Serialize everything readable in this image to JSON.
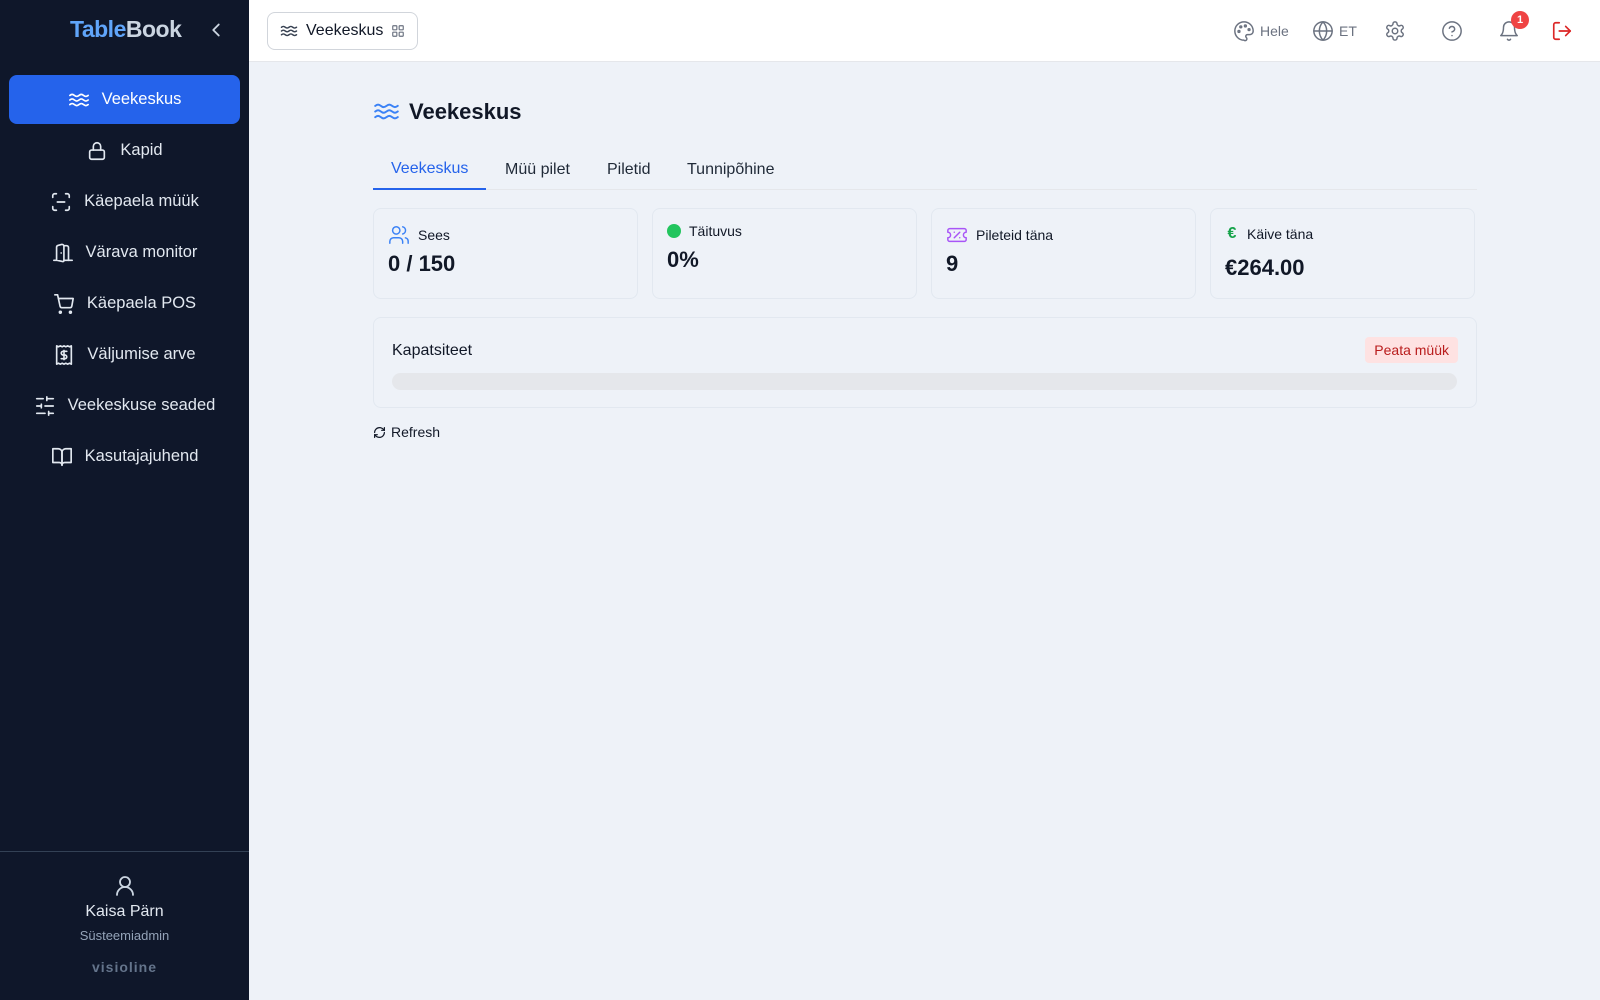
{
  "sidebar": {
    "brand_part1": "Table",
    "brand_part2": "Book",
    "items": [
      {
        "label": "Veekeskus",
        "icon": "waves-icon",
        "active": true
      },
      {
        "label": "Kapid",
        "icon": "lock-icon"
      },
      {
        "label": "Käepaela müük",
        "icon": "scan-icon"
      },
      {
        "label": "Värava monitor",
        "icon": "door-icon"
      },
      {
        "label": "Käepaela POS",
        "icon": "cart-icon"
      },
      {
        "label": "Väljumise arve",
        "icon": "receipt-icon"
      },
      {
        "label": "Veekeskuse seaded",
        "icon": "sliders-icon"
      },
      {
        "label": "Kasutajajuhend",
        "icon": "book-icon"
      }
    ],
    "user": {
      "name": "Kaisa Pärn",
      "role": "Süsteemiadmin"
    },
    "vendor": "visioline"
  },
  "header": {
    "module": "Veekeskus",
    "theme_label": "Hele",
    "language_label": "ET",
    "notification_count": "1"
  },
  "main": {
    "title": "Veekeskus",
    "tabs": [
      {
        "label": "Veekeskus",
        "active": true
      },
      {
        "label": "Müü pilet"
      },
      {
        "label": "Piletid"
      },
      {
        "label": "Tunnipõhine"
      }
    ],
    "stats": [
      {
        "label": "Sees",
        "value": "0 / 150",
        "icon": "users-icon"
      },
      {
        "label": "Täituvus",
        "value": "0%",
        "icon": "status-dot"
      },
      {
        "label": "Pileteid täna",
        "value": "9",
        "icon": "ticket-icon"
      },
      {
        "label": "Käive täna",
        "value": "€264.00",
        "icon": "euro-icon",
        "icon_text": "€"
      }
    ],
    "capacity": {
      "title": "Kapatsiteet",
      "stop_label": "Peata müük",
      "fill_percent": 0
    },
    "refresh_label": "Refresh"
  },
  "colors": {
    "sidebar_bg": "#0f172a",
    "accent": "#2563eb",
    "success": "#22c55e",
    "danger": "#ef4444",
    "ticket": "#a855f7"
  }
}
